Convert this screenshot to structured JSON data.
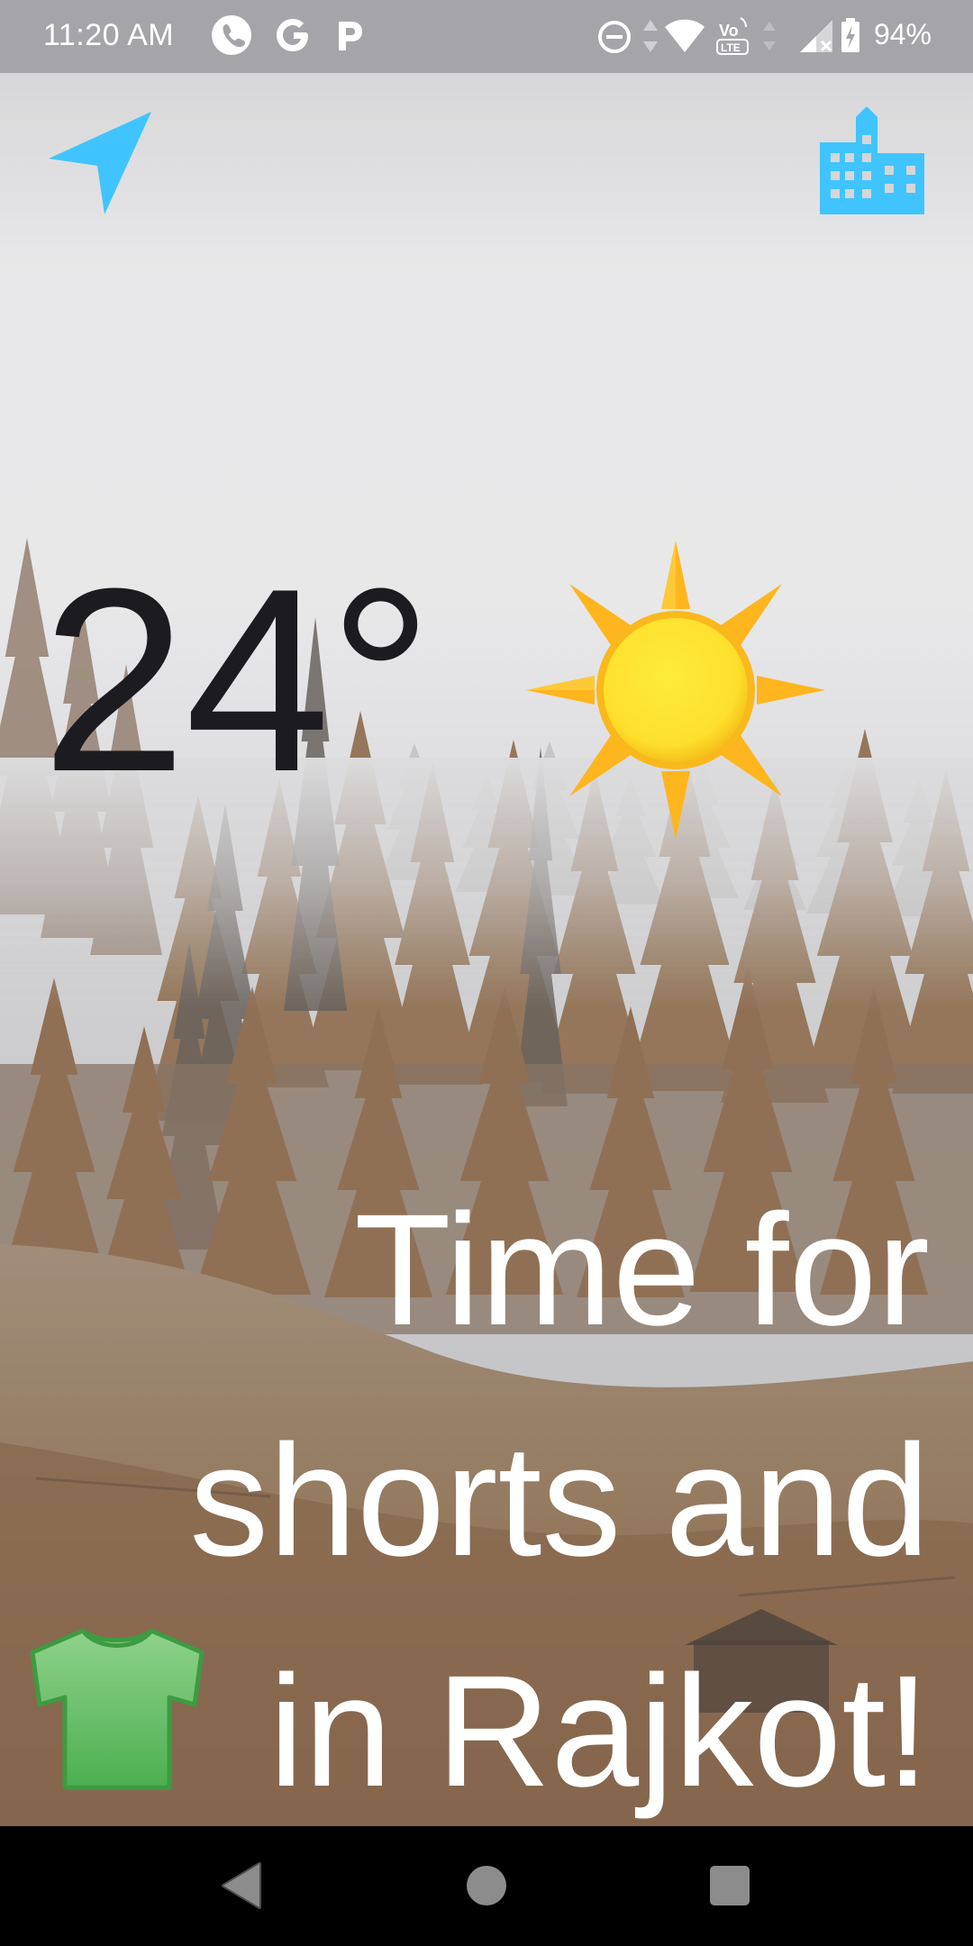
{
  "status_bar": {
    "time": "11:20 AM",
    "battery": "94%",
    "left_icons": [
      "phone-icon",
      "google-icon",
      "parking-icon"
    ],
    "right_icons": [
      "do-not-disturb-icon",
      "data-arrows-icon",
      "wifi-icon",
      "volte-icon",
      "signal-icon",
      "battery-charging-icon"
    ]
  },
  "toolbar": {
    "location_icon": "navigation-arrow-icon",
    "city_icon": "city-icon",
    "accent_color": "#40c4ff"
  },
  "weather": {
    "temperature": "24°",
    "condition_icon": "sun-icon"
  },
  "message": {
    "line1": "Time for",
    "line2": "shorts and",
    "line3": "in Rajkot!",
    "clothing_icon": "t-shirt-icon"
  },
  "nav_bar": {
    "icons": [
      "back-icon",
      "home-icon",
      "recents-icon"
    ]
  }
}
